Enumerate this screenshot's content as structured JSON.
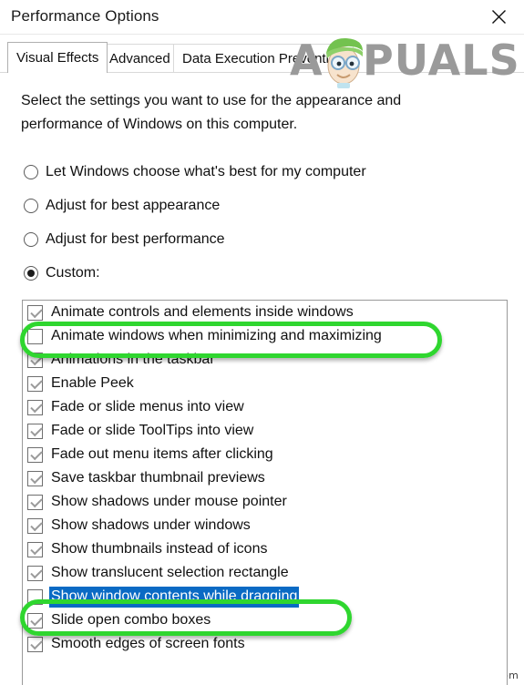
{
  "window": {
    "title": "Performance Options",
    "close_icon": "close-icon"
  },
  "tabs": [
    {
      "label": "Visual Effects",
      "selected": true
    },
    {
      "label": "Advanced",
      "selected": false
    },
    {
      "label": "Data Execution Prevention",
      "selected": false
    }
  ],
  "description": "Select the settings you want to use for the appearance and performance of Windows on this computer.",
  "radio_options": [
    {
      "label": "Let Windows choose what's best for my computer",
      "selected": false
    },
    {
      "label": "Adjust for best appearance",
      "selected": false
    },
    {
      "label": "Adjust for best performance",
      "selected": false
    },
    {
      "label": "Custom:",
      "selected": true
    }
  ],
  "effects_list": [
    {
      "label": "Animate controls and elements inside windows",
      "checked": true,
      "selected": false,
      "annotated": false
    },
    {
      "label": "Animate windows when minimizing and maximizing",
      "checked": false,
      "selected": false,
      "annotated": true
    },
    {
      "label": "Animations in the taskbar",
      "checked": true,
      "selected": false,
      "annotated": false
    },
    {
      "label": "Enable Peek",
      "checked": true,
      "selected": false,
      "annotated": false
    },
    {
      "label": "Fade or slide menus into view",
      "checked": true,
      "selected": false,
      "annotated": false
    },
    {
      "label": "Fade or slide ToolTips into view",
      "checked": true,
      "selected": false,
      "annotated": false
    },
    {
      "label": "Fade out menu items after clicking",
      "checked": true,
      "selected": false,
      "annotated": false
    },
    {
      "label": "Save taskbar thumbnail previews",
      "checked": true,
      "selected": false,
      "annotated": false
    },
    {
      "label": "Show shadows under mouse pointer",
      "checked": true,
      "selected": false,
      "annotated": false
    },
    {
      "label": "Show shadows under windows",
      "checked": true,
      "selected": false,
      "annotated": false
    },
    {
      "label": "Show thumbnails instead of icons",
      "checked": true,
      "selected": false,
      "annotated": false
    },
    {
      "label": "Show translucent selection rectangle",
      "checked": true,
      "selected": false,
      "annotated": false
    },
    {
      "label": "Show window contents while dragging",
      "checked": false,
      "selected": true,
      "annotated": true
    },
    {
      "label": "Slide open combo boxes",
      "checked": true,
      "selected": false,
      "annotated": false
    },
    {
      "label": "Smooth edges of screen fonts",
      "checked": true,
      "selected": false,
      "annotated": false
    }
  ],
  "watermarks": {
    "brand": "PUALS",
    "brand_prefix": "A",
    "site": "wsxdn.com"
  },
  "colors": {
    "selection_blue": "#0a6ac4",
    "annotation_green": "#2fd62f",
    "watermark_gray": "#9a9a9a",
    "hair_green": "#73c24f",
    "text": "#101010"
  }
}
